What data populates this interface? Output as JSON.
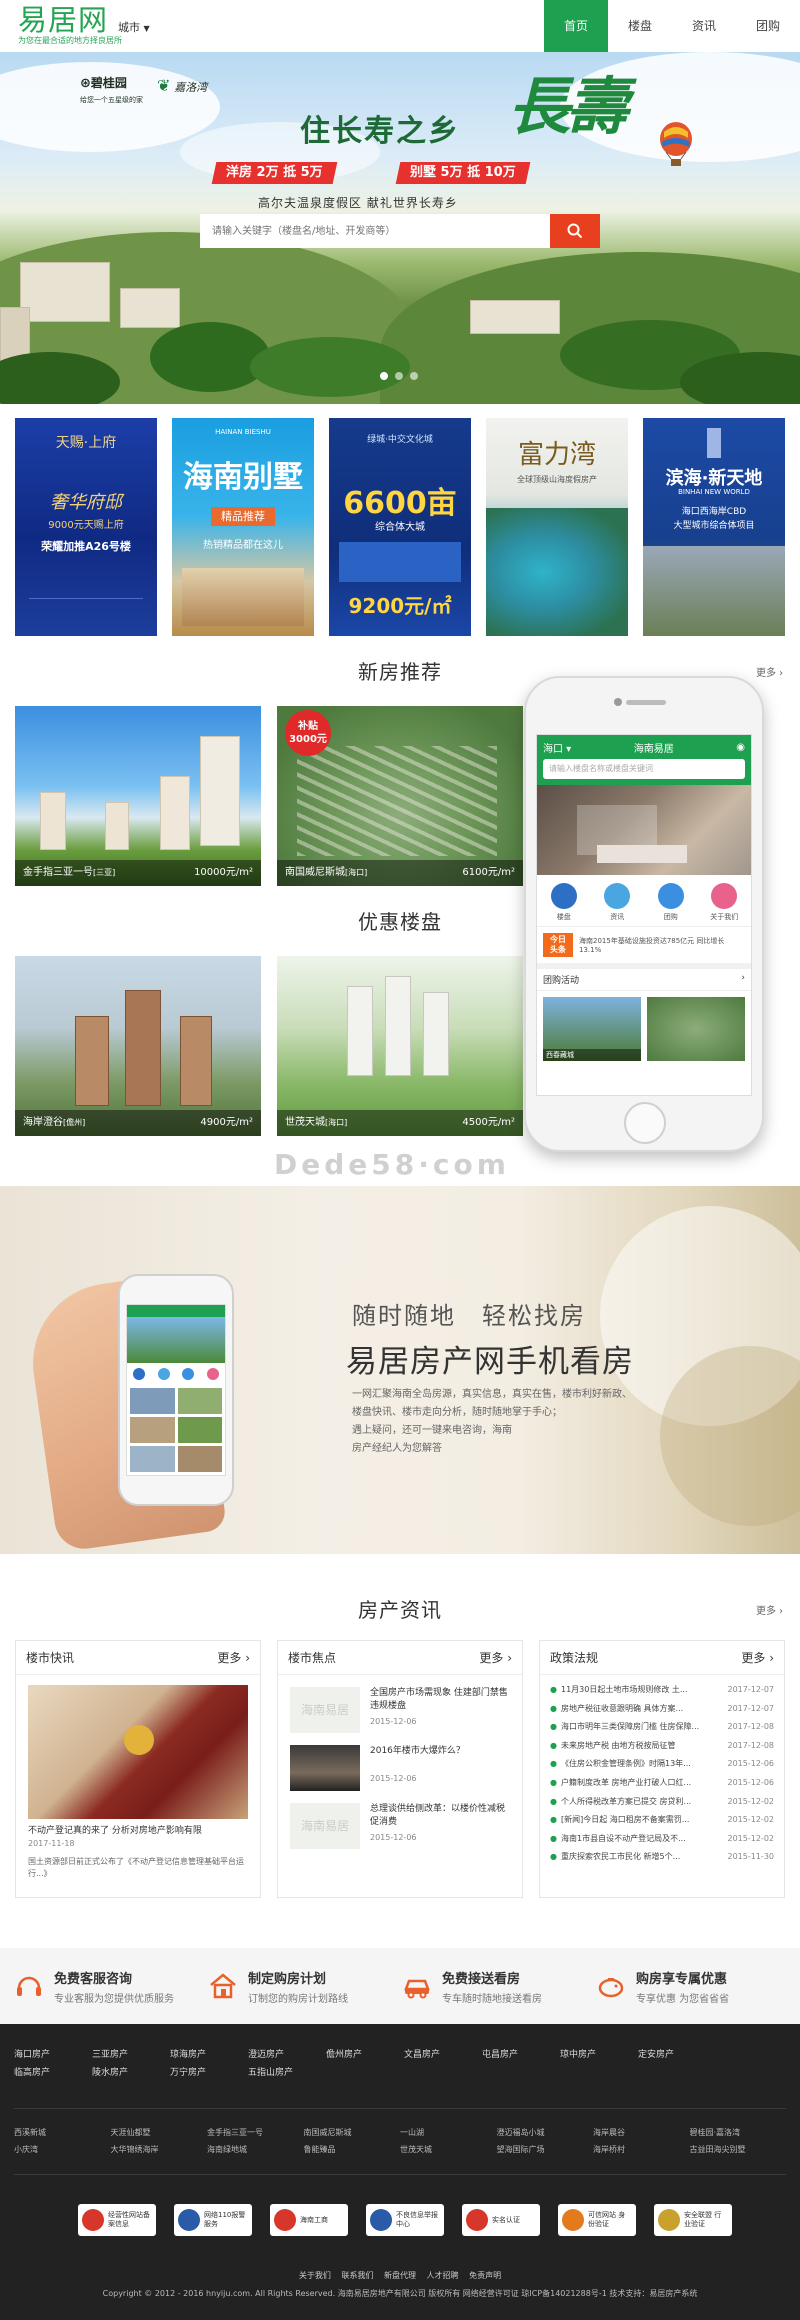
{
  "header": {
    "logo_title": "易居网",
    "logo_tagline": "为您在最合适的地方择良居所",
    "city_label": "城市",
    "nav": [
      {
        "label": "首页",
        "active": true
      },
      {
        "label": "楼盘",
        "active": false
      },
      {
        "label": "资讯",
        "active": false
      },
      {
        "label": "团购",
        "active": false
      }
    ]
  },
  "banner": {
    "brand_logo_1": "碧桂园",
    "brand_logo_1_sub": "给您一个五星级的家",
    "brand_logo_2": "嘉洛湾",
    "headline": "住长寿之乡",
    "headline_big": "長壽",
    "promo_1": "洋房 2万 抵 5万",
    "promo_2": "别墅 5万 抵 10万",
    "subline": "高尔夫温泉度假区  献礼世界长寿乡",
    "search_placeholder": "请输入关键字（楼盘名/地址、开发商等）",
    "slide_count": 3,
    "active_slide": 0
  },
  "ads": [
    {
      "line1": "天赐·上府",
      "line2": "奢华府邸",
      "line3": "9000元天赐上府",
      "line4": "荣耀加推A26号楼"
    },
    {
      "line1": "HAINAN BIESHU",
      "line2": "海南别墅",
      "line3": "精品推荐",
      "line4": "热销精品都在这儿"
    },
    {
      "line1": "绿城·中交文化城",
      "line2": "6600亩",
      "line3": "综合体大城",
      "line4": "9200元/㎡"
    },
    {
      "line1": "富力湾",
      "line2": "全球顶级山海度假房产",
      "line3": "",
      "line4": ""
    },
    {
      "line1": "滨海·新天地",
      "line2": "BINHAI NEW WORLD",
      "line3": "海口西海岸CBD",
      "line4": "大型城市综合体项目"
    }
  ],
  "sections": {
    "new_homes_title": "新房推荐",
    "deals_title": "优惠楼盘",
    "news_title": "房产资讯",
    "more_label": "更多"
  },
  "new_homes": [
    {
      "name": "金手指三亚一号",
      "tag": "[三亚]",
      "price": "10000元/m²"
    },
    {
      "name": "南国威尼斯城",
      "tag": "[海口]",
      "price": "6100元/m²",
      "badge": "补贴3000元"
    }
  ],
  "deals": [
    {
      "name": "海岸澄谷",
      "tag": "[儋州]",
      "price": "4900元/m²"
    },
    {
      "name": "世茂天城",
      "tag": "[海口]",
      "price": "4500元/m²"
    }
  ],
  "phone": {
    "city": "海口",
    "app_title": "海南易居",
    "search_placeholder": "请输入楼盘名称或楼盘关键词",
    "icons": [
      {
        "label": "楼盘",
        "color": "#2d6fc4"
      },
      {
        "label": "资讯",
        "color": "#49a6e0"
      },
      {
        "label": "团购",
        "color": "#3a8fe0"
      },
      {
        "label": "关于我们",
        "color": "#e8628c"
      }
    ],
    "news_badge_1": "今日",
    "news_badge_2": "头条",
    "news_line1": "海南2015年基础设施投资达785亿元 同比增长",
    "news_line2": "13.1%",
    "group_label": "团购活动",
    "thumb_1": "西春藏城",
    "thumb_2": ""
  },
  "watermark": "Dede58·com",
  "promo": {
    "line1": "随时随地　轻松找房",
    "line2": "易居房产网手机看房",
    "desc": [
      "一网汇聚海南全岛房源，真实信息，真实在售，楼市利好新政、",
      "楼盘快讯、楼市走向分析，随时随地掌于手心；",
      "遇上疑问，还可一键来电咨询，海南",
      "房产经纪人为您解答"
    ]
  },
  "news": {
    "col1": {
      "title": "楼市快讯",
      "item_title": "不动产登记真的来了 分析对房地产影响有限",
      "item_date": "2017-11-18",
      "item_desc": "国土资源部日前正式公布了《不动产登记信息管理基础平台运行...》"
    },
    "col2": {
      "title": "楼市焦点",
      "items": [
        {
          "text": "全国房产市场需现象 住建部门禁售违规楼盘",
          "date": "2015-12-06",
          "img": "海南易居"
        },
        {
          "text": "2016年楼市大爆炸么？",
          "date": "2015-12-06",
          "img": ""
        },
        {
          "text": "总理谈供给侧改革：以楼价性减税促消费",
          "date": "2015-12-06",
          "img": "海南易居"
        }
      ]
    },
    "col3": {
      "title": "政策法规",
      "items": [
        {
          "text": "11月30日起土地市场规则修改 土...",
          "date": "2017-12-07"
        },
        {
          "text": "房地产税征收意跟明确 具体方案...",
          "date": "2017-12-07"
        },
        {
          "text": "海口市明年三类保障房门槛 住房保障...",
          "date": "2017-12-08"
        },
        {
          "text": "未来房地产税 由地方税按局征管",
          "date": "2017-12-08"
        },
        {
          "text": "《住房公积金管理条例》时隔13年...",
          "date": "2015-12-06"
        },
        {
          "text": "户籍制度改革 房地产业打破人口红...",
          "date": "2015-12-06"
        },
        {
          "text": "个人所得税改革方案已提交 房贷利...",
          "date": "2015-12-02"
        },
        {
          "text": "[新闻]今日起 海口租房不备案需罚...",
          "date": "2015-12-02"
        },
        {
          "text": "海南1市县自设不动产登记局及不...",
          "date": "2015-12-02"
        },
        {
          "text": "重庆探索农民工市民化 新增5个...",
          "date": "2015-11-30"
        }
      ]
    }
  },
  "services": [
    {
      "title": "免费客服咨询",
      "sub": "专业客服为您提供优质服务",
      "color": "#e8612c"
    },
    {
      "title": "制定购房计划",
      "sub": "订制您的购房计划路线",
      "color": "#e8612c"
    },
    {
      "title": "免费接送看房",
      "sub": "专车随时随地接送看房",
      "color": "#e8612c"
    },
    {
      "title": "购房享专属优惠",
      "sub": "专享优惠 为您省省省",
      "color": "#e8612c"
    }
  ],
  "footer": {
    "cities": [
      "海口房产",
      "三亚房产",
      "琼海房产",
      "澄迈房产",
      "儋州房产",
      "文昌房产",
      "屯昌房产",
      "琼中房产",
      "定安房产",
      "临高房产",
      "陵水房产",
      "万宁房产",
      "五指山房产"
    ],
    "links": [
      "西溪新城",
      "天涯仙都墅",
      "金手指三亚一号",
      "南国威尼斯城",
      "一山湖",
      "澄迈福岛小城",
      "海岸晨谷",
      "碧桂园·嘉洛湾",
      "小庆湾",
      "大华锦绣海岸",
      "海南绿地城",
      "鲁能臻品",
      "世茂天城",
      "望海国际广场",
      "海岸桥村",
      "古益田海尖别墅"
    ],
    "badges": [
      {
        "text": "经营性网站备案信息",
        "color": "#d7362b"
      },
      {
        "text": "网络110报警服务",
        "color": "#2a5aa8"
      },
      {
        "text": "海南工商",
        "color": "#d7362b"
      },
      {
        "text": "不良信息举报中心",
        "color": "#2a5aa8"
      },
      {
        "text": "实名认证",
        "color": "#d7362b"
      },
      {
        "text": "可信网站 身份验证",
        "color": "#e37a1c"
      },
      {
        "text": "安全联盟 行业验证",
        "color": "#c8a22c"
      }
    ],
    "links2": [
      "关于我们",
      "联系我们",
      "新盘代理",
      "人才招聘",
      "免责声明"
    ],
    "copyright": "Copyright © 2012 - 2016 hnyiju.com. All Rights Reserved. 海南易居房地产有限公司 版权所有    网络经营许可证    琼ICP备14021288号-1    技术支持：易居房产系统"
  }
}
